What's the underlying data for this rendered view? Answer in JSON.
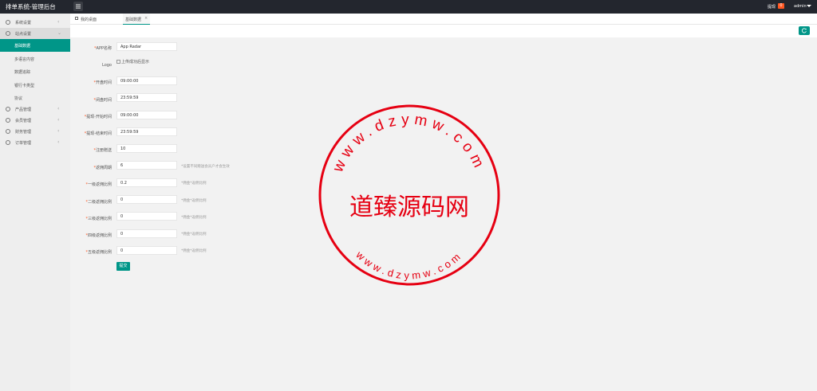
{
  "header": {
    "app_title": "排单系统-管理后台",
    "tip_label": "提现",
    "tip_count": "0",
    "user_name": "admin"
  },
  "sidebar": {
    "items": [
      {
        "label": "系统设置",
        "icon": "gear-icon"
      },
      {
        "label": "站点设置",
        "icon": "home-icon"
      },
      {
        "label": "产品管理",
        "icon": "box-icon"
      },
      {
        "label": "会员管理",
        "icon": "user-icon"
      },
      {
        "label": "财务管理",
        "icon": "money-icon"
      },
      {
        "label": "订单管理",
        "icon": "order-icon"
      }
    ],
    "sub_items": [
      {
        "label": "基础数据"
      },
      {
        "label": "多语言内容"
      },
      {
        "label": "数据追踪"
      },
      {
        "label": "银行卡类型"
      },
      {
        "label": "协议"
      }
    ]
  },
  "tabs": [
    {
      "label": "我的桌面"
    },
    {
      "label": "基础数据"
    }
  ],
  "form": {
    "app_name": {
      "label": "APP名称",
      "value": "App Radar"
    },
    "logo": {
      "label": "Logo",
      "alt": "上传成功后显示"
    },
    "open_time": {
      "label": "开盘时间",
      "value": "09:00:00"
    },
    "close_time": {
      "label": "闭盘时间",
      "value": "23:59:59"
    },
    "withdraw_start": {
      "label": "提现-开始时间",
      "value": "09:00:00"
    },
    "withdraw_end": {
      "label": "提现-结束时间",
      "value": "23:59:59"
    },
    "register_bonus": {
      "label": "注册赠送",
      "value": "10"
    },
    "rebate_period": {
      "label": "返佣周期",
      "value": "6",
      "hint": "*设置不同赠送会员户才会生效"
    },
    "level1": {
      "label": "一级返佣比例",
      "value": "0.2",
      "hint": "*佣金*返佣比例"
    },
    "level2": {
      "label": "二级返佣比例",
      "value": "0",
      "hint": "*佣金*返佣比例"
    },
    "level3": {
      "label": "三级返佣比例",
      "value": "0",
      "hint": "*佣金*返佣比例"
    },
    "level4": {
      "label": "四级返佣比例",
      "value": "0",
      "hint": "*佣金*返佣比例"
    },
    "level5": {
      "label": "五级返佣比例",
      "value": "0",
      "hint": "*佣金*返佣比例"
    },
    "submit_label": "提交"
  },
  "watermark": {
    "center_text": "道臻源码网",
    "top_text": "www.dzymw.com",
    "bottom_text": "www.dzymw.com",
    "color": "#e60012"
  },
  "colors": {
    "accent": "#009688",
    "topbar": "#23262e",
    "badge": "#ff5722"
  }
}
